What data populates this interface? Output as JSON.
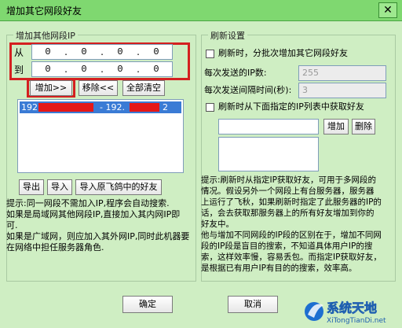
{
  "window": {
    "title": "增加其它网段好友"
  },
  "left_group": {
    "legend": "增加其他网段IP",
    "from_label": "从",
    "to_label": "到",
    "from_ip": [
      "0",
      "0",
      "0",
      "0"
    ],
    "to_ip": [
      "0",
      "0",
      "0",
      "0"
    ],
    "add_button": "增加>>",
    "remove_button": "移除<<",
    "clear_button": "全部清空",
    "list_row": {
      "start_prefix": "192.",
      "separator": "- 192.",
      "end_suffix": "2"
    },
    "export_button": "导出",
    "import_button": "导入",
    "import_feige_button": "导入原飞鸽中的好友",
    "hint_lines": [
      "提示:同一网段不需加入IP,程序会自动搜索.",
      "如果是局域网其他网段IP,直接加入其内网IP即",
      "可.",
      "如果是广域网，则应加入其外网IP,同时此机器要",
      "在网络中担任服务器角色."
    ]
  },
  "right_group": {
    "legend": "刷新设置",
    "batch_refresh_label": "刷新时，分批次增加其它网段好友",
    "ip_count_label": "每次发送的IP数:",
    "ip_count_value": "255",
    "interval_label": "每次发送间隔时间(秒):",
    "interval_value": "3",
    "from_list_label": "刷新时从下面指定的IP列表中获取好友",
    "add_button": "增加",
    "delete_button": "删除",
    "hint_lines": [
      "提示:刷新时从指定IP获取好友，可用于多网段的",
      "情况。假设另外一个网段上有台服务器，服务器",
      "上运行了飞秋，如果刷新时指定了此服务器的IP的",
      "话，会去获取那服务器上的所有好友增加到你的",
      "好友中。",
      "他与增加不同网段的IP段的区别在于，增加不同网",
      "段的IP段是盲目的搜索，不知道具体用户IP的搜",
      "索，这样效率慢，容易丢包。而指定IP获取好友，",
      "是根据已有用户IP有目的的搜索，效率高。"
    ]
  },
  "footer": {
    "ok_button": "确定",
    "cancel_button": "取消"
  },
  "watermark": {
    "text": "系统天地",
    "url": "XiTongTianDi.net"
  },
  "colors": {
    "background": "#cfeec3",
    "titlebar": "#7fd870",
    "highlight_box": "#d42020",
    "selection": "#3a7bd5",
    "redaction": "#e51818"
  }
}
